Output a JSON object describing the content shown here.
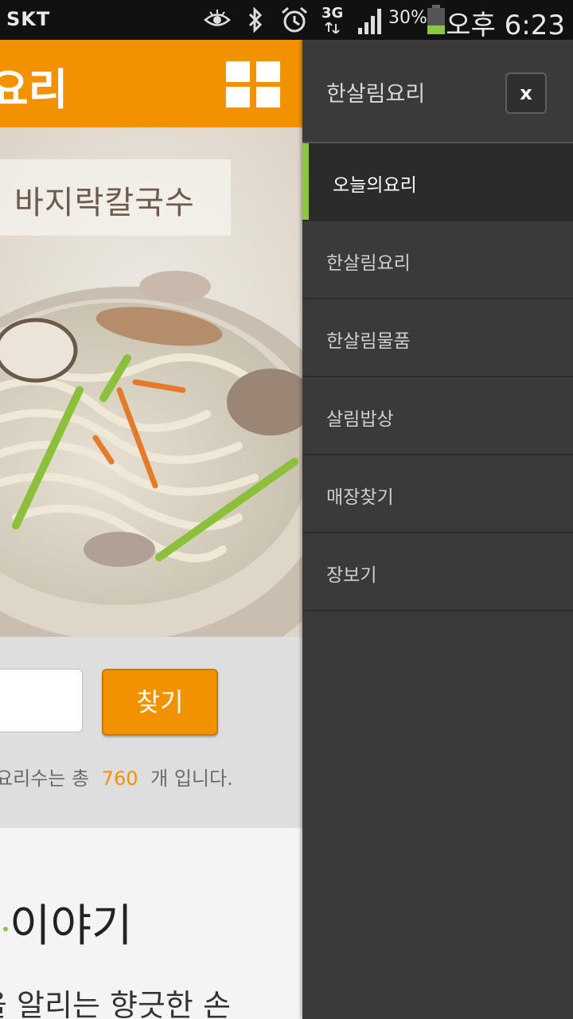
{
  "status_bar": {
    "carrier": "SKT",
    "network": "3G",
    "battery": "30%",
    "time": "오후 6:23",
    "icons": [
      "eye-icon",
      "bluetooth-icon",
      "alarm-icon",
      "signal-icon",
      "battery-icon"
    ]
  },
  "page": {
    "logo": "요리",
    "hero_title": "바지락칼국수",
    "search_button": "찾기",
    "count_prefix": "요리수는 총",
    "count_value": "760",
    "count_suffix": "개 입니다.",
    "story_title": "이야기",
    "story_subtitle": "을 알리는 향긋한 손"
  },
  "drawer": {
    "title": "한살림요리",
    "close_label": "x",
    "items": [
      {
        "label": "오늘의요리",
        "active": true
      },
      {
        "label": "한살림요리"
      },
      {
        "label": "한살림물품"
      },
      {
        "label": "살림밥상"
      },
      {
        "label": "매장찾기"
      },
      {
        "label": "장보기"
      }
    ]
  },
  "colors": {
    "brand_orange": "#f39200",
    "active_green": "#8dc63f",
    "drawer_bg": "#3a3a3a"
  }
}
